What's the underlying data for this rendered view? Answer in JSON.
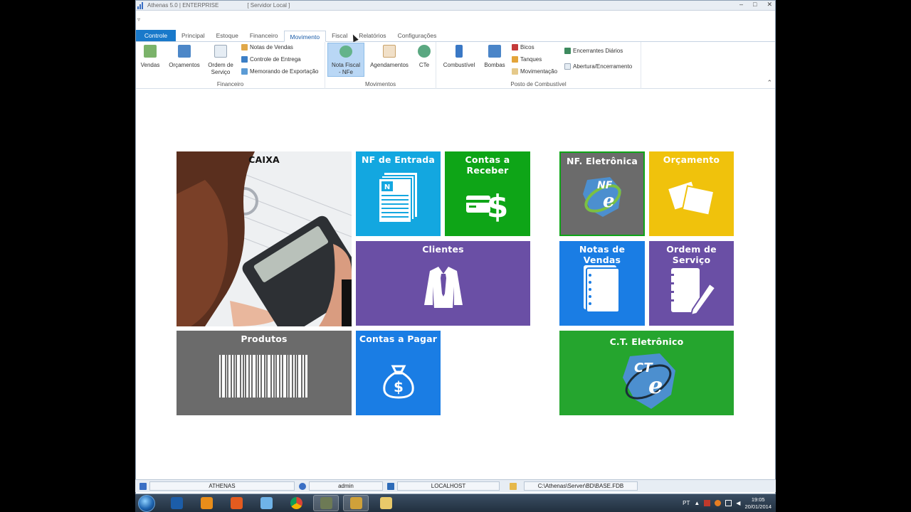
{
  "window": {
    "title": "Athenas 5.0 | ENTERPRISE",
    "server": "[ Servidor Local ]",
    "qat_glyph": "▿"
  },
  "tabs": [
    "Controle",
    "Principal",
    "Estoque",
    "Financeiro",
    "Movimento",
    "Fiscal",
    "Relatórios",
    "Configurações"
  ],
  "ribbon": {
    "financeiro": {
      "title": "Financeiro",
      "vendas": "Vendas",
      "orcamentos": "Orçamentos",
      "ordem1": "Ordem de",
      "ordem2": "Serviço",
      "notas": "Notas de Vendas",
      "controle": "Controle de Entrega",
      "memorando": "Memorando de Exportação"
    },
    "movimentos": {
      "title": "Movimentos",
      "nf1": "Nota Fiscal",
      "nf2": "- NFe",
      "agend": "Agendamentos",
      "cte": "CTe"
    },
    "posto": {
      "title": "Posto de Combustível",
      "comb": "Combustível",
      "bombas": "Bombas",
      "bicos": "Bicos",
      "tanques": "Tanques",
      "mov": "Movimentação",
      "encerr": "Encerrantes Diários",
      "abert": "Abertura/Encerramento"
    }
  },
  "tiles": {
    "caixa": "CAIXA",
    "nf_entrada": "NF de Entrada",
    "contas_receber": "Contas a Receber",
    "clientes": "Clientes",
    "produtos": "Produtos",
    "contas_pagar": "Contas a Pagar",
    "nf_eletronica": "NF. Eletrônica",
    "orcamento": "Orçamento",
    "notas_vendas": "Notas de Vendas",
    "ordem_servico": "Ordem de Serviço",
    "ct_eletronico": "C.T. Eletrônico",
    "nfe_logo": "NF",
    "cte_logo": "CT",
    "e_letter": "e",
    "doc_letter": "N",
    "dollar": "$"
  },
  "status": {
    "app": "ATHENAS",
    "user": "admin",
    "host": "LOCALHOST",
    "db": "C:\\Athenas\\Server\\BD\\BASE.FDB"
  },
  "tray": {
    "lang": "PT",
    "time": "19:05",
    "date": "20/01/2014"
  },
  "colors": {
    "cyan": "#13a7e0",
    "green": "#0ea517",
    "purple": "#6a4fa5",
    "gray": "#6b6b6b",
    "blue": "#1a7de4",
    "yellow": "#f0c20c"
  }
}
